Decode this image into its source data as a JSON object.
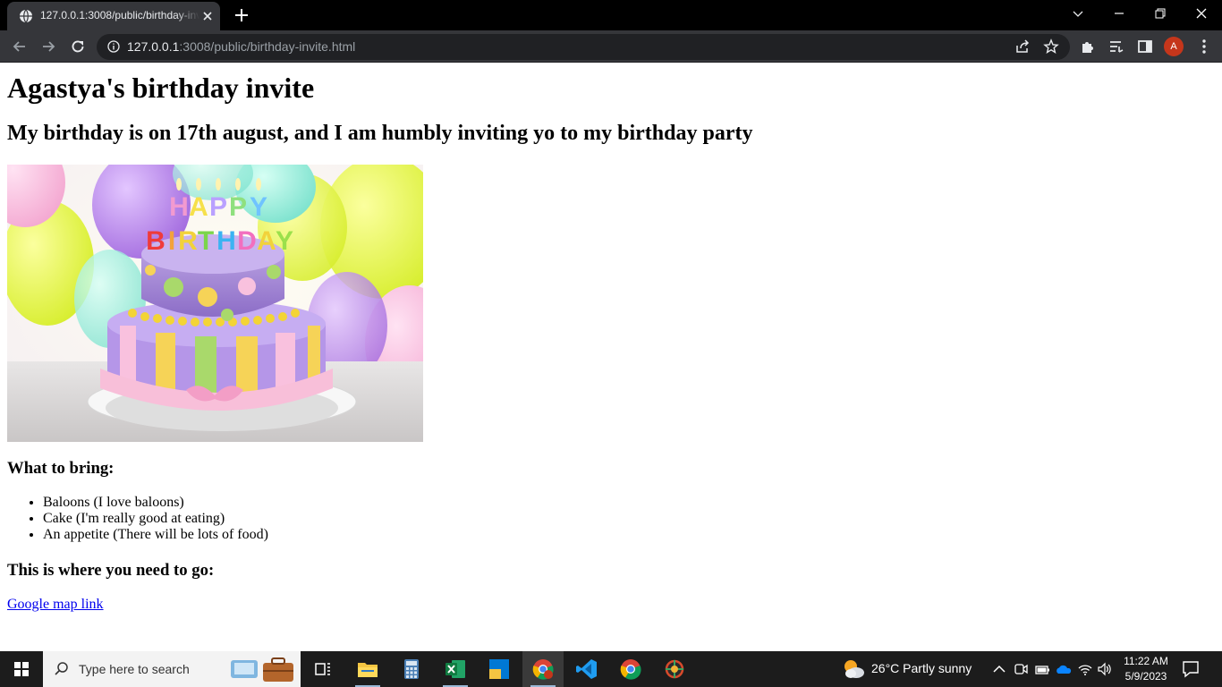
{
  "browser": {
    "tab_title": "127.0.0.1:3008/public/birthday-invite.html",
    "url_host": "127.0.0.1",
    "url_path": ":3008/public/birthday-invite.html",
    "avatar_letter": "A"
  },
  "page": {
    "heading": "Agastya's birthday invite",
    "subheading": "My birthday is on 17th august, and I am humbly inviting yo to my birthday party",
    "image_text": {
      "happy": [
        "H",
        "A",
        "P",
        "P",
        "Y"
      ],
      "birthday": [
        "B",
        "I",
        "R",
        "T",
        "H",
        "D",
        "A",
        "Y"
      ]
    },
    "bring_heading": "What to bring:",
    "bring_items": [
      "Baloons (I love baloons)",
      "Cake (I'm really good at eating)",
      "An appetite (There will be lots of food)"
    ],
    "where_heading": "This is where you need to go:",
    "map_link": "Google map link"
  },
  "taskbar": {
    "search_placeholder": "Type here to search",
    "weather": "26°C  Partly sunny",
    "time": "11:22 AM",
    "date": "5/9/2023"
  },
  "colors": {
    "tab_active": "#35363a",
    "omnibox": "#202124",
    "link": "#0000ee",
    "avatar": "#c5361b",
    "taskbar": "#1c1c1c"
  },
  "icons": [
    "globe-icon",
    "close-icon",
    "plus-icon",
    "back-icon",
    "forward-icon",
    "reload-icon",
    "info-icon",
    "share-icon",
    "star-icon",
    "extensions-icon",
    "reading-list-icon",
    "side-panel-icon",
    "menu-icon",
    "windows-icon",
    "search-icon",
    "task-view-icon",
    "file-explorer-icon",
    "calculator-icon",
    "excel-icon",
    "chrome-icon",
    "vscode-icon",
    "weather-icon",
    "wifi-icon",
    "volume-icon",
    "notification-icon"
  ]
}
